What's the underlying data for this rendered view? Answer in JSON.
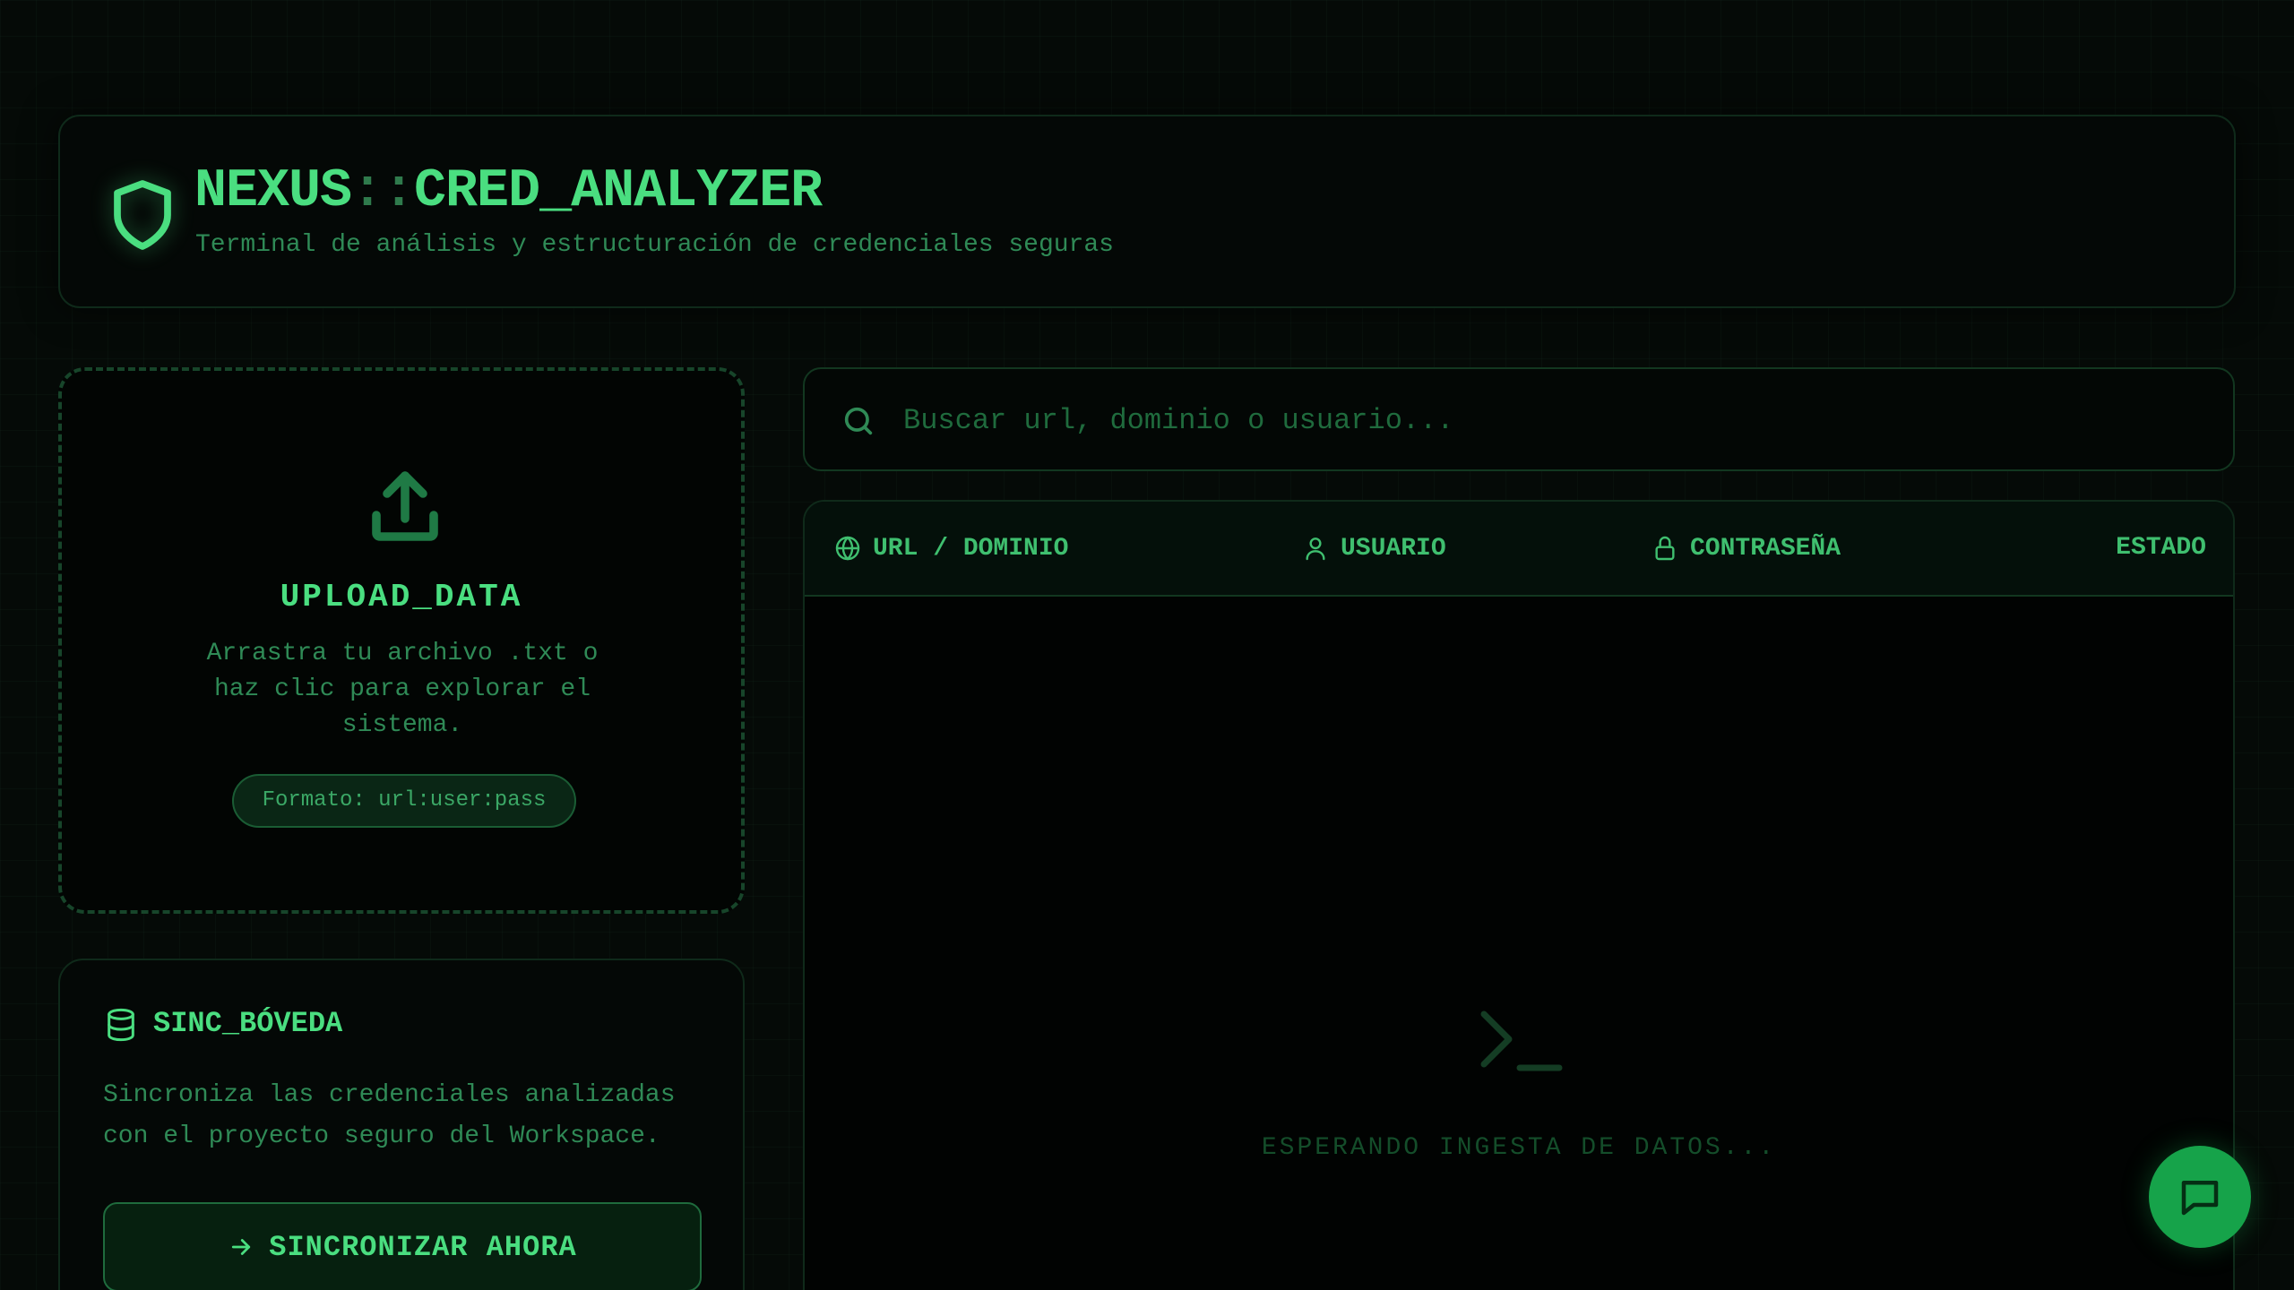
{
  "colors": {
    "background": "#050a07",
    "accent": "#4ade80",
    "muted": "#2f8a56",
    "fab": "#16a34a"
  },
  "header": {
    "title_prefix": "NEXUS",
    "title_separator": "::",
    "title_suffix": "CRED_ANALYZER",
    "subtitle": "Terminal de análisis y estructuración de credenciales seguras",
    "icon": "shield-icon"
  },
  "upload": {
    "icon": "upload-icon",
    "title": "UPLOAD_DATA",
    "description": "Arrastra tu archivo .txt o haz clic para explorar el sistema.",
    "format_badge": "Formato: url:user:pass"
  },
  "sync": {
    "icon": "database-icon",
    "title": "SINC_BÓVEDA",
    "description": "Sincroniza las credenciales analizadas con el proyecto seguro del Workspace.",
    "button_label": "SINCRONIZAR AHORA"
  },
  "search": {
    "placeholder": "Buscar url, dominio o usuario...",
    "value": ""
  },
  "table": {
    "columns": [
      {
        "label": "URL / DOMINIO",
        "icon": "globe-icon"
      },
      {
        "label": "USUARIO",
        "icon": "user-icon"
      },
      {
        "label": "CONTRASEÑA",
        "icon": "lock-icon"
      },
      {
        "label": "ESTADO"
      }
    ],
    "rows": [],
    "empty_state": {
      "icon": "terminal-icon",
      "message": "ESPERANDO INGESTA DE DATOS..."
    }
  },
  "chat": {
    "icon": "chat-icon"
  }
}
